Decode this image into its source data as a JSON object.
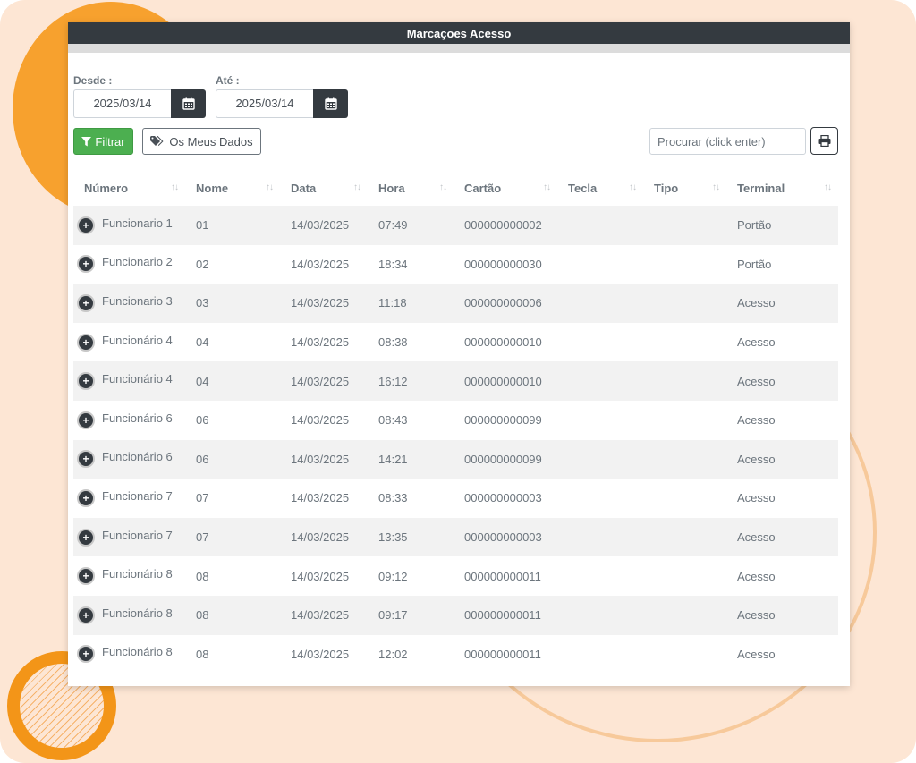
{
  "window": {
    "title": "Marcaçoes Acesso"
  },
  "filters": {
    "from_label": "Desde :",
    "from_value": "2025/03/14",
    "to_label": "Até :",
    "to_value": "2025/03/14"
  },
  "toolbar": {
    "filter_label": "Filtrar",
    "my_data_label": "Os Meus Dados",
    "search_placeholder": "Procurar (click enter)"
  },
  "icons": {
    "calendar": "calendar-icon",
    "filter": "filter-icon",
    "tags": "tags-icon",
    "print": "print-icon",
    "expand": "plus-circle-icon",
    "sort": "sort-icon"
  },
  "colors": {
    "header": "#343a40",
    "filter_button": "#4caf50",
    "background": "#fde6d4",
    "accent_orange": "#f7a12e"
  },
  "table": {
    "columns": [
      "Número",
      "Nome",
      "Data",
      "Hora",
      "Cartão",
      "Tecla",
      "Tipo",
      "Terminal"
    ],
    "rows": [
      {
        "numero": "Funcionario 1",
        "nome": "01",
        "data": "14/03/2025",
        "hora": "07:49",
        "cartao": "000000000002",
        "tecla": "",
        "tipo": "",
        "terminal": "Portão"
      },
      {
        "numero": "Funcionario 2",
        "nome": "02",
        "data": "14/03/2025",
        "hora": "18:34",
        "cartao": "000000000030",
        "tecla": "",
        "tipo": "",
        "terminal": "Portão"
      },
      {
        "numero": "Funcionario 3",
        "nome": "03",
        "data": "14/03/2025",
        "hora": "11:18",
        "cartao": "000000000006",
        "tecla": "",
        "tipo": "",
        "terminal": "Acesso"
      },
      {
        "numero": "Funcionário 4",
        "nome": "04",
        "data": "14/03/2025",
        "hora": "08:38",
        "cartao": "000000000010",
        "tecla": "",
        "tipo": "",
        "terminal": "Acesso"
      },
      {
        "numero": "Funcionário 4",
        "nome": "04",
        "data": "14/03/2025",
        "hora": "16:12",
        "cartao": "000000000010",
        "tecla": "",
        "tipo": "",
        "terminal": "Acesso"
      },
      {
        "numero": "Funcionário 6",
        "nome": "06",
        "data": "14/03/2025",
        "hora": "08:43",
        "cartao": "000000000099",
        "tecla": "",
        "tipo": "",
        "terminal": "Acesso"
      },
      {
        "numero": "Funcionário 6",
        "nome": "06",
        "data": "14/03/2025",
        "hora": "14:21",
        "cartao": "000000000099",
        "tecla": "",
        "tipo": "",
        "terminal": "Acesso"
      },
      {
        "numero": "Funcionario 7",
        "nome": "07",
        "data": "14/03/2025",
        "hora": "08:33",
        "cartao": "000000000003",
        "tecla": "",
        "tipo": "",
        "terminal": "Acesso"
      },
      {
        "numero": "Funcionario 7",
        "nome": "07",
        "data": "14/03/2025",
        "hora": "13:35",
        "cartao": "000000000003",
        "tecla": "",
        "tipo": "",
        "terminal": "Acesso"
      },
      {
        "numero": "Funcionário 8",
        "nome": "08",
        "data": "14/03/2025",
        "hora": "09:12",
        "cartao": "000000000011",
        "tecla": "",
        "tipo": "",
        "terminal": "Acesso"
      },
      {
        "numero": "Funcionário 8",
        "nome": "08",
        "data": "14/03/2025",
        "hora": "09:17",
        "cartao": "000000000011",
        "tecla": "",
        "tipo": "",
        "terminal": "Acesso"
      },
      {
        "numero": "Funcionário 8",
        "nome": "08",
        "data": "14/03/2025",
        "hora": "12:02",
        "cartao": "000000000011",
        "tecla": "",
        "tipo": "",
        "terminal": "Acesso"
      }
    ]
  }
}
